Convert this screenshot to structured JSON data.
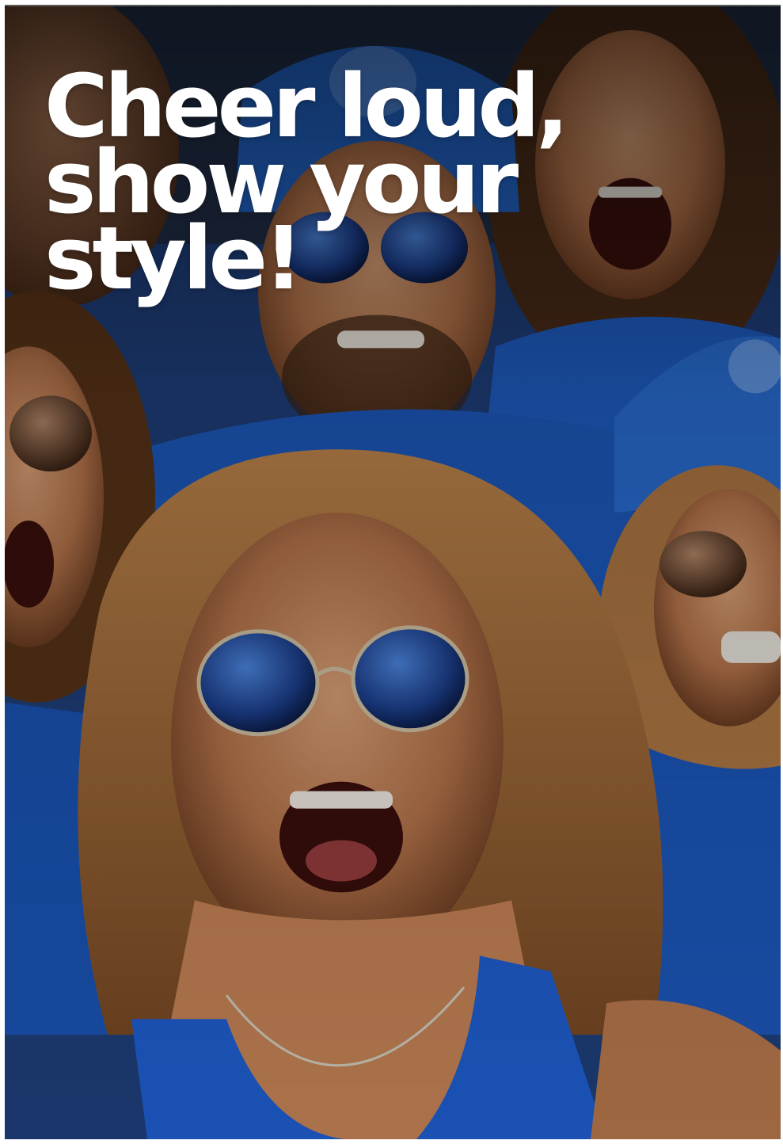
{
  "headline": {
    "lines": [
      "Cheer loud,",
      "show your",
      "style!"
    ]
  },
  "photo": {
    "subject": "crowd-of-fans-icon"
  },
  "colors": {
    "accent_blue": "#1f5fc8",
    "text": "#ffffff",
    "overlay": "#0b1424"
  }
}
